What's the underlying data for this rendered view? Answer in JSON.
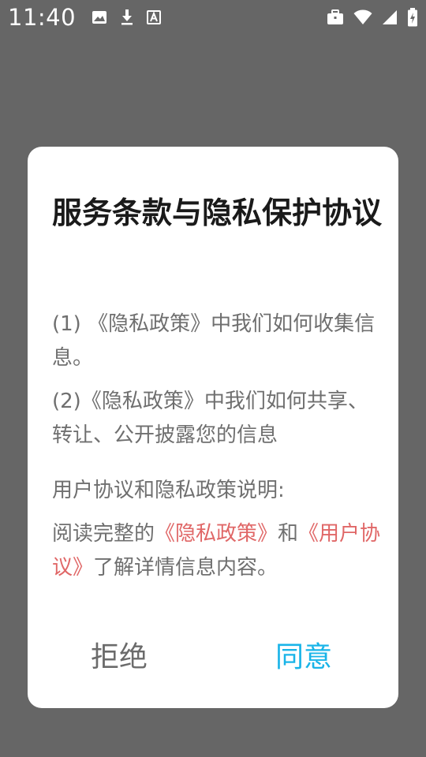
{
  "status_bar": {
    "time": "11:40",
    "left_icons": [
      "image-icon",
      "download-icon",
      "font-icon"
    ],
    "right_icons": [
      "briefcase-icon",
      "wifi-icon",
      "signal-icon",
      "battery-charging-icon"
    ]
  },
  "dialog": {
    "title": "服务条款与隐私保护协议",
    "items": [
      "(1) 《隐私政策》中我们如何收集信息。",
      "(2)《隐私政策》中我们如何共享、转让、公开披露您的信息"
    ],
    "explain_heading": "用户协议和隐私政策说明:",
    "explain_prefix": "阅读完整的",
    "privacy_link": "《隐私政策》",
    "and_text": "和",
    "agreement_link": "《用户协议》",
    "explain_suffix": "了解详情信息内容。",
    "reject_label": "拒绝",
    "agree_label": "同意"
  },
  "colors": {
    "overlay": "#666666",
    "link": "#e06767",
    "agree": "#19b4e8",
    "reject": "#6b6b6b"
  }
}
